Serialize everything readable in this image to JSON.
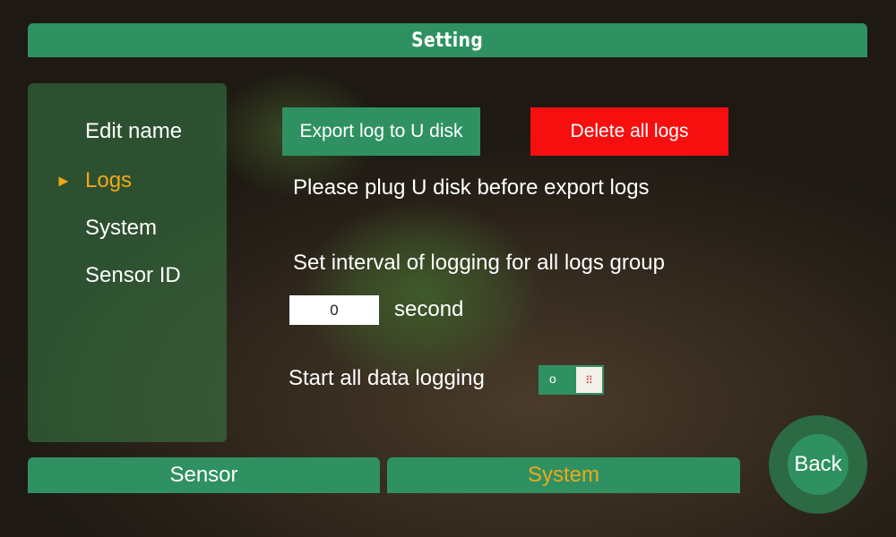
{
  "header": {
    "title": "Setting"
  },
  "sidebar": {
    "items": [
      {
        "label": "Edit name"
      },
      {
        "label": "Logs"
      },
      {
        "label": "System"
      },
      {
        "label": "Sensor ID"
      }
    ],
    "active_marker": "►"
  },
  "main": {
    "export_label": "Export log to U disk",
    "delete_label": "Delete all logs",
    "plug_hint": "Please plug U disk before export logs",
    "interval_label": "Set interval of logging for all logs group",
    "interval_value": "0",
    "interval_unit": "second",
    "start_logging_label": "Start all data logging",
    "toggle_off_label": "o",
    "toggle_state": "off"
  },
  "tabs": [
    {
      "label": "Sensor"
    },
    {
      "label": "System"
    }
  ],
  "back_label": "Back",
  "colors": {
    "accent_green": "#2f9161",
    "active_orange": "#f0a818",
    "danger_red": "#f70f0f"
  }
}
